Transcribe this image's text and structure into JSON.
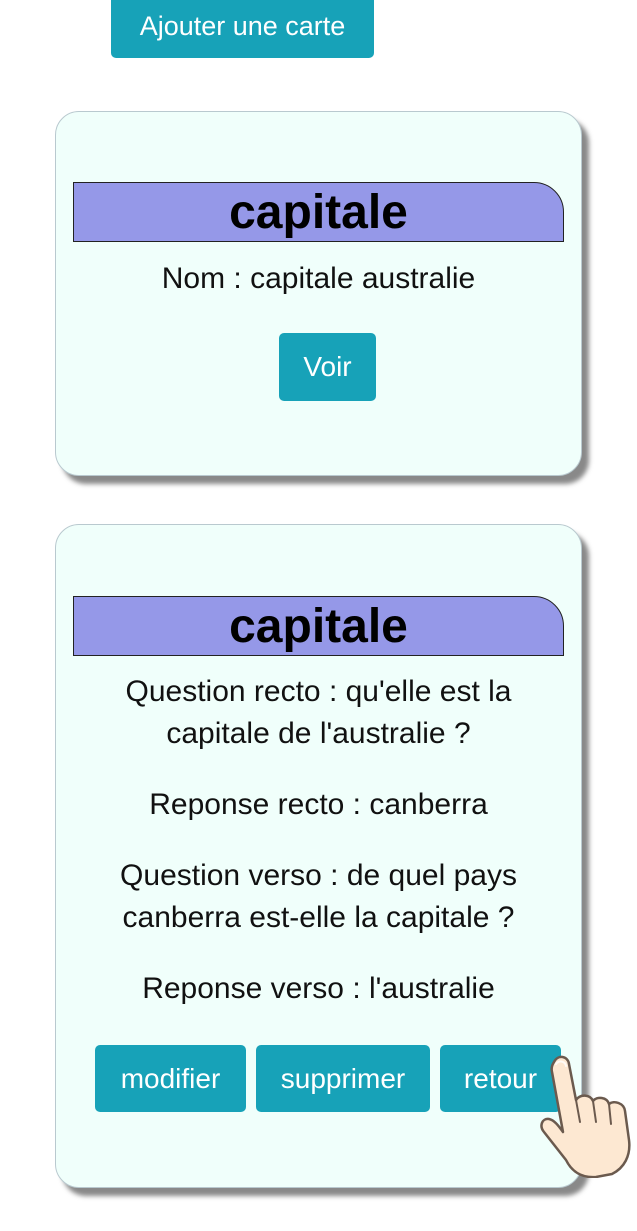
{
  "toolbar": {
    "add_card_label": "Ajouter une carte"
  },
  "card_summary": {
    "category": "capitale",
    "name_line": "Nom : capitale australie",
    "view_label": "Voir"
  },
  "card_detail": {
    "category": "capitale",
    "question_recto": "Question recto : qu'elle est la capitale de l'australie ?",
    "reponse_recto": "Reponse recto : canberra",
    "question_verso": "Question verso : de quel pays canberra est-elle la capitale ?",
    "reponse_verso": "Reponse verso : l'australie",
    "actions": {
      "modify_label": "modifier",
      "delete_label": "supprimer",
      "back_label": "retour"
    }
  },
  "colors": {
    "button": "#17a2b8",
    "card_background": "#f0fffb",
    "header_background": "#9598e8"
  },
  "icons": {
    "cursor": "pointing-hand-icon"
  }
}
